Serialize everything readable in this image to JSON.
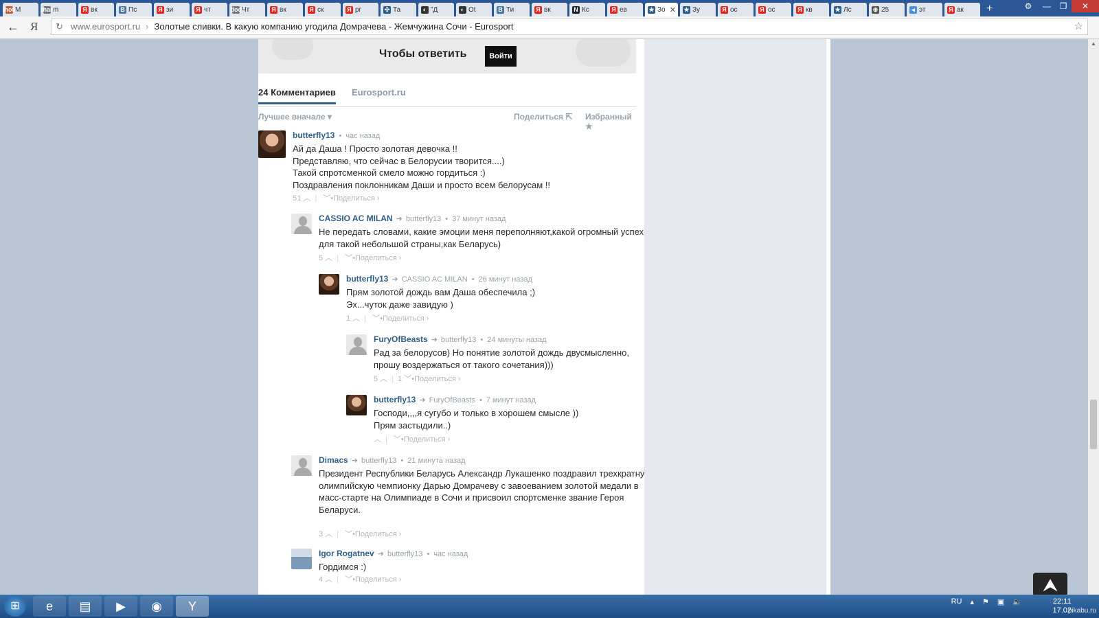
{
  "browser": {
    "tabs": [
      {
        "label": "M",
        "icon": "photo",
        "color": "#c06040"
      },
      {
        "label": "m",
        "icon": "chart",
        "color": "#777"
      },
      {
        "label": "вк",
        "icon": "Я",
        "color": "#e52620"
      },
      {
        "label": "Пс",
        "icon": "В",
        "color": "#4a76a8"
      },
      {
        "label": "зи",
        "icon": "Я",
        "color": "#e52620"
      },
      {
        "label": "чт",
        "icon": "Я",
        "color": "#e52620"
      },
      {
        "label": "Чт",
        "icon": "doc",
        "color": "#777"
      },
      {
        "label": "вк",
        "icon": "Я",
        "color": "#e52620"
      },
      {
        "label": "ск",
        "icon": "Я",
        "color": "#e52620"
      },
      {
        "label": "рг",
        "icon": "Я",
        "color": "#e52620"
      },
      {
        "label": "Та",
        "icon": "✣",
        "color": "#2e5e88"
      },
      {
        "label": "\"Д",
        "icon": "◐",
        "color": "#333"
      },
      {
        "label": "Ot",
        "icon": "◐",
        "color": "#333"
      },
      {
        "label": "Ти",
        "icon": "В",
        "color": "#4a76a8"
      },
      {
        "label": "вк",
        "icon": "Я",
        "color": "#e52620"
      },
      {
        "label": "Кс",
        "icon": "N",
        "color": "#222"
      },
      {
        "label": "ев",
        "icon": "Я",
        "color": "#e52620"
      },
      {
        "label": "Зо",
        "icon": "★",
        "color": "#2e5e88",
        "active": true
      },
      {
        "label": "Зу",
        "icon": "★",
        "color": "#2e5e88"
      },
      {
        "label": "ос",
        "icon": "Я",
        "color": "#e52620"
      },
      {
        "label": "ос",
        "icon": "Я",
        "color": "#e52620"
      },
      {
        "label": "кв",
        "icon": "Я",
        "color": "#e52620"
      },
      {
        "label": "Лс",
        "icon": "★",
        "color": "#2e5e88"
      },
      {
        "label": "25",
        "icon": "⊕",
        "color": "#555"
      },
      {
        "label": "эт",
        "icon": "◂",
        "color": "#4a90d9"
      },
      {
        "label": "ак",
        "icon": "Я",
        "color": "#e52620"
      }
    ],
    "new_tab": "+",
    "yandex_btn": "Я",
    "url_domain": "www.eurosport.ru",
    "url_sep": "›",
    "page_title": "Золотые сливки. В какую компанию угодила Домрачева - Жемчужина Сочи - Eurosport"
  },
  "reply": {
    "title": "Чтобы ответить",
    "login_label": "Войти"
  },
  "comment_tabs": {
    "count_label": "24 Комментариев",
    "site_label": "Eurosport.ru"
  },
  "sortbar": {
    "sort_label": "Лучшее вначале ▾",
    "share_label": "Поделиться ⇱",
    "fav_label": "Избранный ★"
  },
  "comments": [
    {
      "author": "butterfly13",
      "reply_to": "",
      "time": "час назад",
      "lines": [
        "Ай да Даша ! Просто золотая девочка !!",
        "Представляю, что сейчас в Белорусии творится....)",
        "Такой спротсменкой смело можно гордиться :)",
        "Поздравления поклонникам Даши и просто всем белорусам !!"
      ],
      "likes": "51",
      "dislikes": "",
      "share": "Поделиться ›"
    },
    {
      "author": "CASSIO AC MILAN",
      "reply_to": "butterfly13",
      "time": "37 минут назад",
      "lines": [
        "Не передать словами, какие эмоции меня переполняют,какой огромный успех",
        "для такой небольшой страны,как Беларусь)"
      ],
      "likes": "5",
      "dislikes": "",
      "share": "Поделиться ›"
    },
    {
      "author": "butterfly13",
      "reply_to": "CASSIO AC MILAN",
      "time": "26 минут назад",
      "lines": [
        "Прям золотой дождь вам Даша обеспечила ;)",
        "Эх...чуток даже завидую )"
      ],
      "likes": "1",
      "dislikes": "",
      "share": "Поделиться ›"
    },
    {
      "author": "FuryOfBeasts",
      "reply_to": "butterfly13",
      "time": "24 минуты назад",
      "lines": [
        "Рад за белорусов) Но понятие золотой дождь двусмысленно,",
        "прошу воздержаться от такого сочетания)))"
      ],
      "likes": "5",
      "dislikes": "1",
      "share": "Поделиться ›"
    },
    {
      "author": "butterfly13",
      "reply_to": "FuryOfBeasts",
      "time": "7 минут назад",
      "lines": [
        "Господи,,,,я сугубо и только в хорошем смысле ))",
        "Прям застыдили..)"
      ],
      "likes": "",
      "dislikes": "",
      "share": "Поделиться ›"
    },
    {
      "author": "Dimacs",
      "reply_to": "butterfly13",
      "time": "21 минута назад",
      "lines": [
        "Президент Республики Беларусь Александр Лукашенко поздравил трехкратную",
        "олимпийскую чемпионку Дарью Домрачеву с завоеванием золотой медали в",
        "масс-старте на Олимпиаде в Сочи и присвоил спортсменке звание Героя",
        "Беларуси."
      ],
      "likes": "3",
      "dislikes": "",
      "share": "Поделиться ›"
    },
    {
      "author": "Igor Rogatnev",
      "reply_to": "butterfly13",
      "time": "час назад",
      "lines": [
        "Гордимся :)"
      ],
      "likes": "4",
      "dislikes": "",
      "share": "Поделиться ›"
    }
  ],
  "taskbar": {
    "lang": "RU",
    "time": "22:11",
    "date": "17.02",
    "watermark": "pikabu.ru"
  }
}
